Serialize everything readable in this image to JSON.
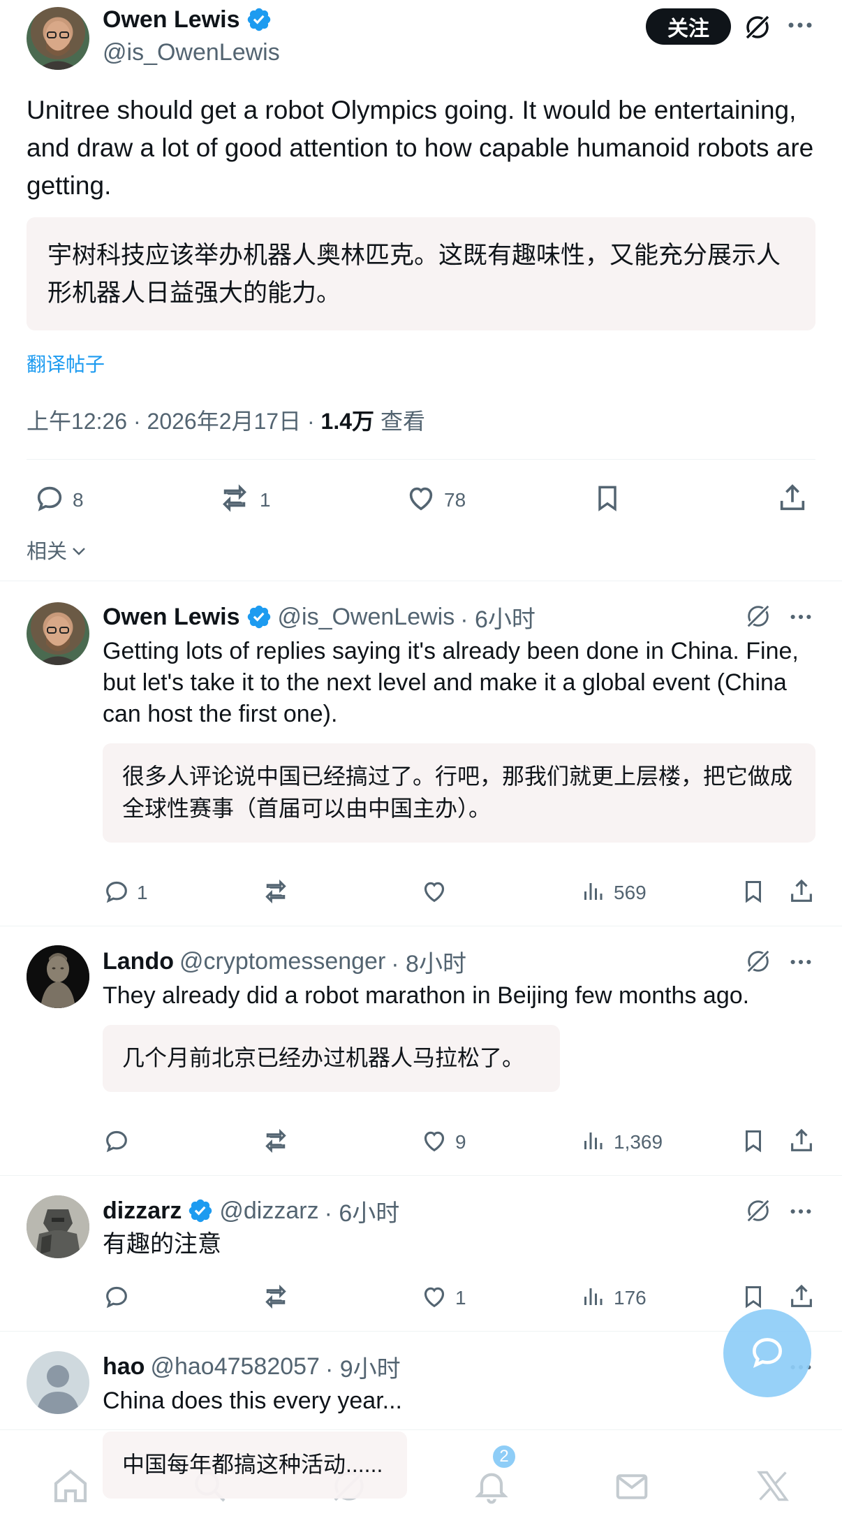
{
  "main_post": {
    "author_name": "Owen Lewis",
    "author_handle": "@is_OwenLewis",
    "follow_label": "关注",
    "text": "Unitree should get a robot Olympics going. It would be entertaining, and draw a lot of good attention to how capable humanoid robots are getting.",
    "translation": "宇树科技应该举办机器人奥林匹克。这既有趣味性，又能充分展示人形机器人日益强大的能力。",
    "translate_link": "翻译帖子",
    "timestamp": "上午12:26 · 2026年2月17日 · ",
    "views_count": "1.4万",
    "views_label": " 查看",
    "replies": "8",
    "reposts": "1",
    "likes": "78",
    "sort_label": "相关"
  },
  "replies": [
    {
      "author_name": "Owen Lewis",
      "author_handle": "@is_OwenLewis",
      "time": "· 6小时",
      "verified": true,
      "text": "Getting lots of replies saying it's already been done in China. Fine, but let's take it to the next level and make it a global event (China can host the first one).",
      "translation": "很多人评论说中国已经搞过了。行吧，那我们就更上层楼，把它做成全球性赛事（首届可以由中国主办）。",
      "replies": "1",
      "reposts": "",
      "likes": "",
      "views": "569"
    },
    {
      "author_name": "Lando",
      "author_handle": "@cryptomessenger",
      "time": "· 8小时",
      "verified": false,
      "text": "They already did a robot marathon in Beijing few months ago.",
      "translation": "几个月前北京已经办过机器人马拉松了。",
      "replies": "",
      "reposts": "",
      "likes": "9",
      "views": "1,369"
    },
    {
      "author_name": "dizzarz",
      "author_handle": "@dizzarz",
      "time": "· 6小时",
      "verified": true,
      "text": "有趣的注意",
      "translation": "",
      "replies": "",
      "reposts": "",
      "likes": "1",
      "views": "176"
    },
    {
      "author_name": "hao",
      "author_handle": "@hao47582057",
      "time": "· 9小时",
      "verified": false,
      "text": "China does this every year...",
      "translation": "中国每年都搞这种活动......"
    }
  ],
  "bottom_nav": {
    "notification_badge": "2"
  },
  "colors": {
    "accent": "#1d9bf0",
    "secondary_text": "#536471",
    "translation_bg": "#f8f3f3",
    "fab": "#8ecdf7"
  }
}
